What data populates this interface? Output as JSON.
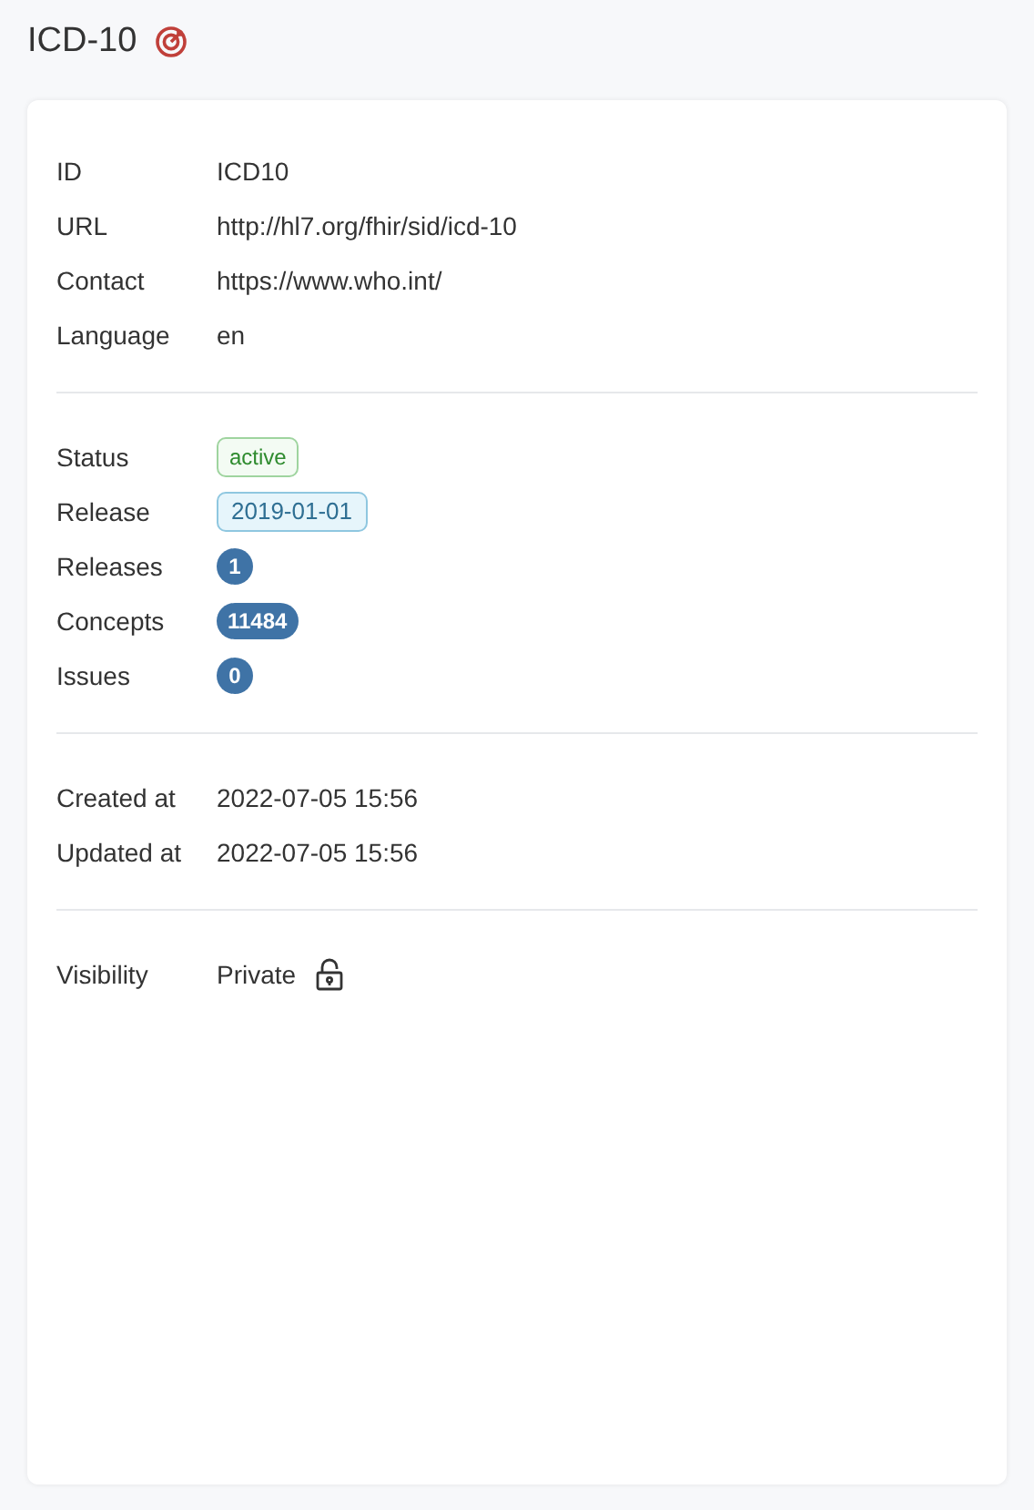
{
  "title": "ICD-10",
  "sections": [
    {
      "rows": [
        {
          "label": "ID",
          "kind": "text",
          "value": "ICD10"
        },
        {
          "label": "URL",
          "kind": "text",
          "value": "http://hl7.org/fhir/sid/icd-10"
        },
        {
          "label": "Contact",
          "kind": "text",
          "value": "https://www.who.int/"
        },
        {
          "label": "Language",
          "kind": "text",
          "value": "en"
        }
      ]
    },
    {
      "rows": [
        {
          "label": "Status",
          "kind": "status",
          "value": "active"
        },
        {
          "label": "Release",
          "kind": "release",
          "value": "2019-01-01"
        },
        {
          "label": "Releases",
          "kind": "count",
          "value": "1"
        },
        {
          "label": "Concepts",
          "kind": "count",
          "value": "11484"
        },
        {
          "label": "Issues",
          "kind": "count",
          "value": "0"
        }
      ]
    },
    {
      "rows": [
        {
          "label": "Created at",
          "kind": "text",
          "value": "2022-07-05 15:56"
        },
        {
          "label": "Updated at",
          "kind": "text",
          "value": "2022-07-05 15:56"
        }
      ]
    },
    {
      "rows": [
        {
          "label": "Visibility",
          "kind": "visibility",
          "value": "Private"
        }
      ]
    }
  ]
}
